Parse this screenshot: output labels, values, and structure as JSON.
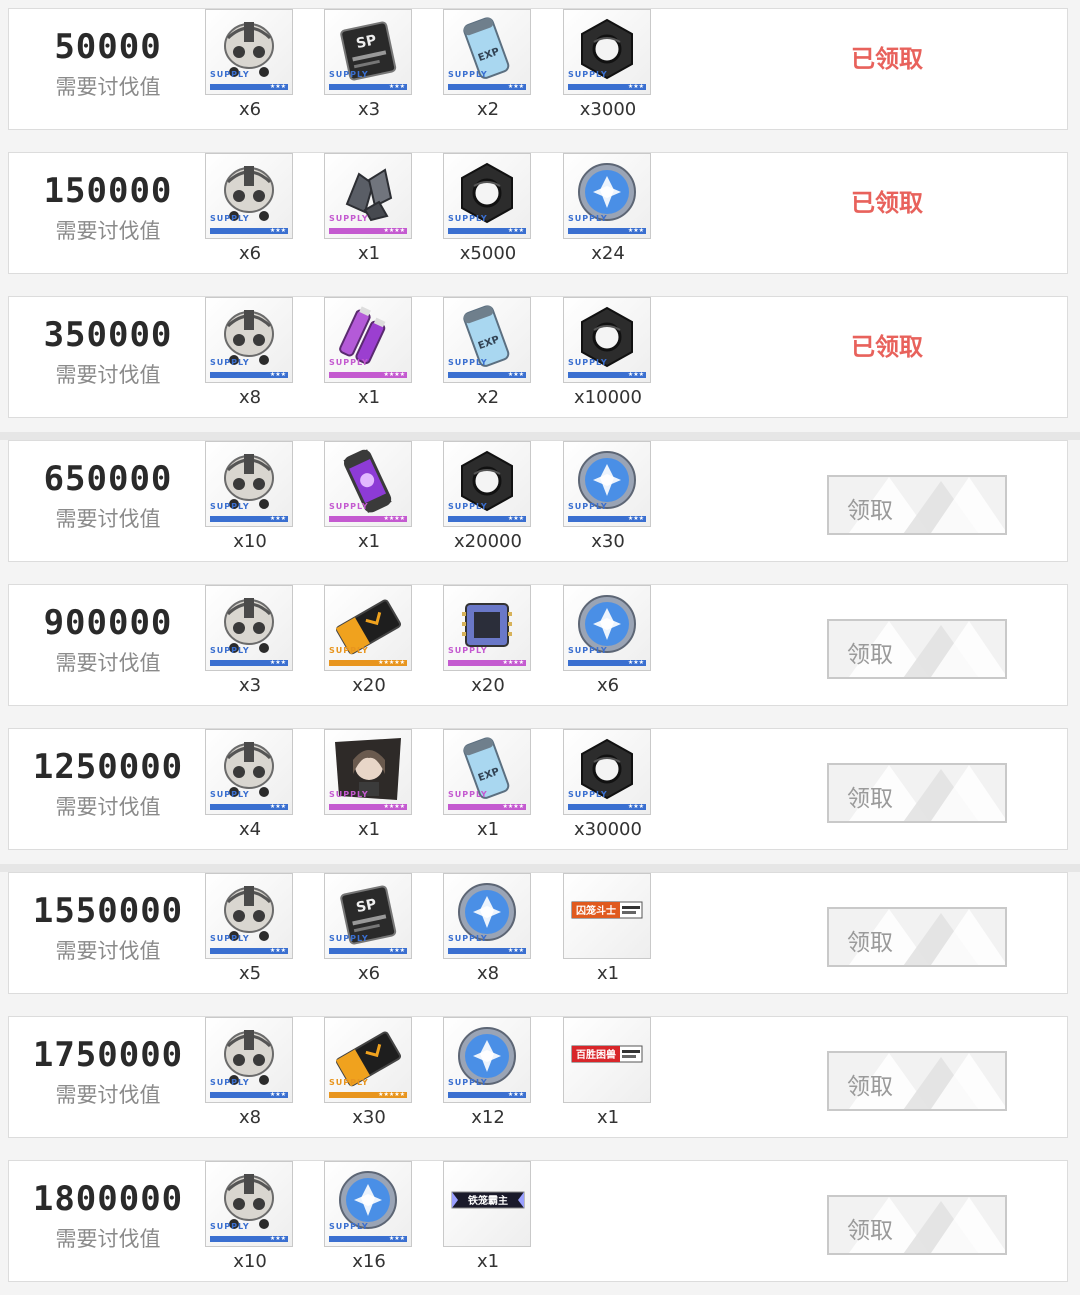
{
  "score_label": "需要讨伐值",
  "claimed_label": "已领取",
  "claim_label": "领取",
  "colors": {
    "claimed": "#e8625c",
    "blue": "#3a6fd0",
    "purple": "#c45ad0",
    "gold": "#e8951e"
  },
  "tiers": [
    {
      "score": "50000",
      "status": "claimed",
      "items": [
        {
          "icon": "skull-mask-icon",
          "rarity": "blue",
          "count": "x6"
        },
        {
          "icon": "sp-card-icon",
          "rarity": "blue",
          "count": "x3"
        },
        {
          "icon": "exp-canister-icon",
          "rarity": "blue",
          "count": "x2"
        },
        {
          "icon": "hex-nut-icon",
          "rarity": "blue",
          "count": "x3000"
        }
      ]
    },
    {
      "score": "150000",
      "status": "claimed",
      "items": [
        {
          "icon": "skull-mask-icon",
          "rarity": "blue",
          "count": "x6"
        },
        {
          "icon": "ore-crystal-icon",
          "rarity": "purple",
          "count": "x1"
        },
        {
          "icon": "hex-nut-icon",
          "rarity": "blue",
          "count": "x5000"
        },
        {
          "icon": "star-coin-icon",
          "rarity": "blue",
          "count": "x24"
        }
      ]
    },
    {
      "score": "350000",
      "status": "claimed",
      "items": [
        {
          "icon": "skull-mask-icon",
          "rarity": "blue",
          "count": "x8"
        },
        {
          "icon": "battery-cells-icon",
          "rarity": "purple",
          "count": "x1"
        },
        {
          "icon": "exp-canister-icon",
          "rarity": "blue",
          "count": "x2"
        },
        {
          "icon": "hex-nut-icon",
          "rarity": "blue",
          "count": "x10000"
        }
      ]
    },
    {
      "score": "650000",
      "status": "open",
      "items": [
        {
          "icon": "skull-mask-icon",
          "rarity": "blue",
          "count": "x10"
        },
        {
          "icon": "energy-tube-icon",
          "rarity": "purple",
          "count": "x1"
        },
        {
          "icon": "hex-nut-icon",
          "rarity": "blue",
          "count": "x20000"
        },
        {
          "icon": "star-coin-icon",
          "rarity": "blue",
          "count": "x30"
        }
      ]
    },
    {
      "score": "900000",
      "status": "open",
      "items": [
        {
          "icon": "skull-mask-icon",
          "rarity": "blue",
          "count": "x3"
        },
        {
          "icon": "gold-ticket-icon",
          "rarity": "gold",
          "count": "x20"
        },
        {
          "icon": "chip-icon",
          "rarity": "purple",
          "count": "x20"
        },
        {
          "icon": "star-coin-icon",
          "rarity": "blue",
          "count": "x6"
        }
      ]
    },
    {
      "score": "1250000",
      "status": "open",
      "items": [
        {
          "icon": "skull-mask-icon",
          "rarity": "blue",
          "count": "x4"
        },
        {
          "icon": "character-portrait-icon",
          "rarity": "purple",
          "count": "x1"
        },
        {
          "icon": "exp-canister-icon",
          "rarity": "purple",
          "count": "x1"
        },
        {
          "icon": "hex-nut-icon",
          "rarity": "blue",
          "count": "x30000"
        }
      ]
    },
    {
      "score": "1550000",
      "status": "open",
      "items": [
        {
          "icon": "skull-mask-icon",
          "rarity": "blue",
          "count": "x5"
        },
        {
          "icon": "sp-card-icon",
          "rarity": "blue",
          "count": "x6"
        },
        {
          "icon": "star-coin-icon",
          "rarity": "blue",
          "count": "x8"
        },
        {
          "icon": "title-badge-icon",
          "rarity": "none",
          "badge_text": "囚笼斗士",
          "badge_color": "#e05a1e",
          "count": "x1"
        }
      ]
    },
    {
      "score": "1750000",
      "status": "open",
      "items": [
        {
          "icon": "skull-mask-icon",
          "rarity": "blue",
          "count": "x8"
        },
        {
          "icon": "gold-ticket-icon",
          "rarity": "gold",
          "count": "x30"
        },
        {
          "icon": "star-coin-icon",
          "rarity": "blue",
          "count": "x12"
        },
        {
          "icon": "title-badge-icon",
          "rarity": "none",
          "badge_text": "百胜困兽",
          "badge_color": "#d8262a",
          "count": "x1"
        }
      ]
    },
    {
      "score": "1800000",
      "status": "open",
      "items": [
        {
          "icon": "skull-mask-icon",
          "rarity": "blue",
          "count": "x10"
        },
        {
          "icon": "star-coin-icon",
          "rarity": "blue",
          "count": "x16"
        },
        {
          "icon": "frame-badge-icon",
          "rarity": "none",
          "badge_text": "铁笼霸主",
          "badge_color": "#1a1a2a",
          "count": "x1"
        }
      ]
    }
  ]
}
